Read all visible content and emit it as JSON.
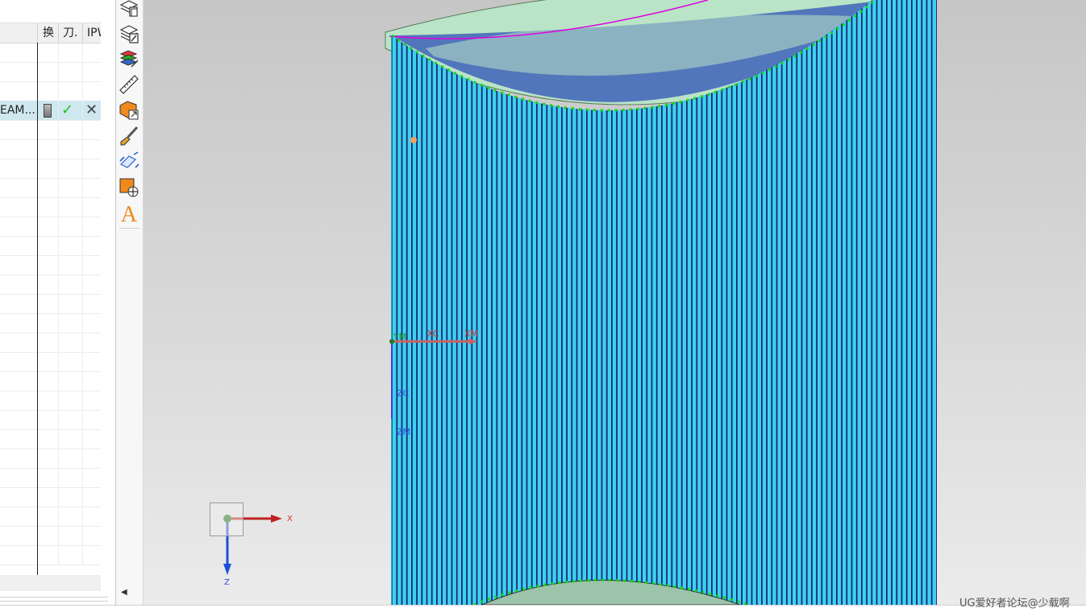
{
  "navigator": {
    "columns": [
      "换",
      "刀.",
      "IPW"
    ],
    "selected_row": {
      "name": "EAM...",
      "status_icons": [
        "pen-icon",
        "check-icon",
        "cross-icon"
      ]
    }
  },
  "viewport": {
    "wcs_labels": {
      "ym": "YM",
      "xc": "XC",
      "xm": "XM",
      "zc": "ZC",
      "zm": "ZM"
    },
    "triad": {
      "x": "X",
      "z": "Z"
    },
    "colors": {
      "toolpath": "#3ed0f2",
      "toolpath_dark": "#1b2a6e",
      "part_face": "#b9e4c7",
      "part_band": "#3f63b8",
      "edge_green": "#14d814",
      "magenta": "#e000e0"
    }
  },
  "toolbar_icons": [
    "copy-operation-icon",
    "edit-operation-icon",
    "layer-icon",
    "measure-ruler-icon",
    "shaded-edge-icon",
    "paint-brush-icon",
    "coordinate-transform-icon",
    "move-object-icon",
    "text-annotation-icon"
  ],
  "watermark": "UG爱好者论坛@少载啊"
}
